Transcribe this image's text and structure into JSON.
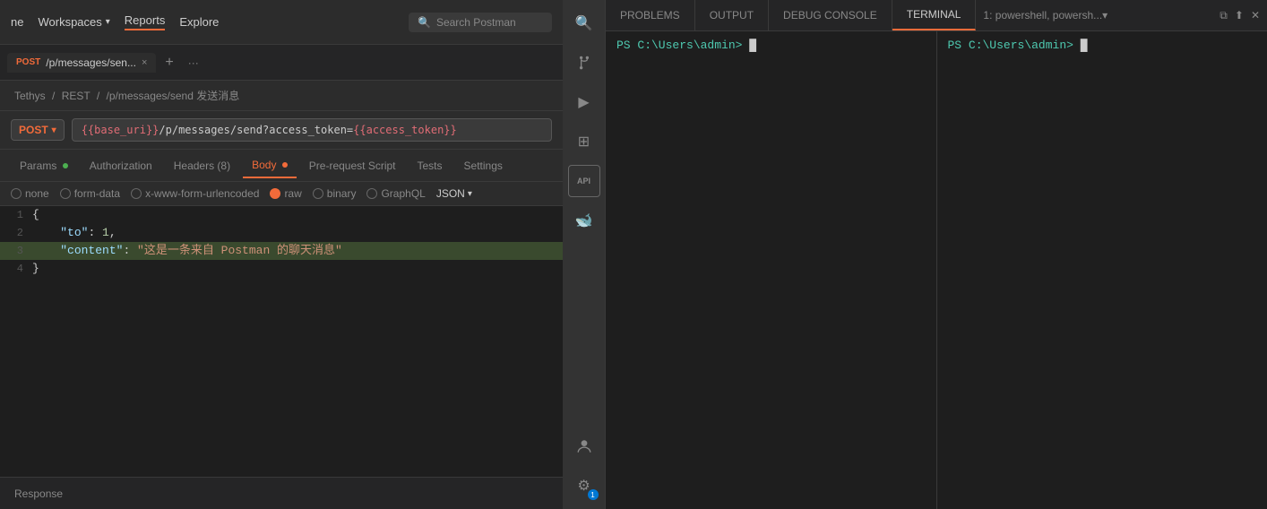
{
  "nav": {
    "home": "ne",
    "workspaces": "Workspaces",
    "reports": "Reports",
    "explore": "Explore",
    "search_placeholder": "Search Postman"
  },
  "tab": {
    "method": "POST",
    "path": "/p/messages/sen...",
    "close": "×"
  },
  "breadcrumb": {
    "workspace": "Tethys",
    "sep1": "/",
    "type": "REST",
    "sep2": "/",
    "endpoint": "/p/messages/send 发送消息"
  },
  "url": {
    "method": "POST",
    "value_prefix": "{{base_uri}}",
    "value_path": "/p/messages/send?access_token=",
    "value_suffix": "{{access_token}}"
  },
  "request_tabs": {
    "params": "Params",
    "authorization": "Authorization",
    "headers": "Headers (8)",
    "body": "Body",
    "pre_request": "Pre-request Script",
    "tests": "Tests",
    "settings": "Settings"
  },
  "body_options": {
    "none": "none",
    "form_data": "form-data",
    "urlencoded": "x-www-form-urlencoded",
    "raw": "raw",
    "binary": "binary",
    "graphql": "GraphQL",
    "json": "JSON"
  },
  "code_lines": [
    {
      "num": "1",
      "content": "{"
    },
    {
      "num": "2",
      "content": "    \"to\": 1,"
    },
    {
      "num": "3",
      "content": "    \"content\": \"这是一条来自 Postman 的聊天消息\""
    },
    {
      "num": "4",
      "content": "}"
    }
  ],
  "response": {
    "label": "Response"
  },
  "vscode_tabs": {
    "problems": "PROBLEMS",
    "output": "OUTPUT",
    "debug": "DEBUG CONSOLE",
    "terminal": "TERMINAL",
    "more": "1: powershell, powersh..."
  },
  "terminals": [
    {
      "prompt": "PS C:\\Users\\admin>",
      "cursor": "█"
    },
    {
      "prompt": "PS C:\\Users\\admin>",
      "cursor": "█"
    }
  ],
  "sidebar": {
    "icons": [
      {
        "name": "search-icon",
        "symbol": "🔍",
        "active": false
      },
      {
        "name": "source-control-icon",
        "symbol": "⎇",
        "active": false
      },
      {
        "name": "run-icon",
        "symbol": "▶",
        "active": false
      },
      {
        "name": "extensions-icon",
        "symbol": "⊞",
        "active": false
      },
      {
        "name": "api-icon",
        "symbol": "API",
        "active": false,
        "text": true
      },
      {
        "name": "docker-icon",
        "symbol": "🐋",
        "active": false
      },
      {
        "name": "account-icon",
        "symbol": "👤",
        "active": false
      },
      {
        "name": "settings-icon",
        "symbol": "⚙",
        "active": false,
        "badge": "1"
      }
    ]
  },
  "colors": {
    "orange": "#f26b3a",
    "terminal_green": "#4ec9b0"
  }
}
